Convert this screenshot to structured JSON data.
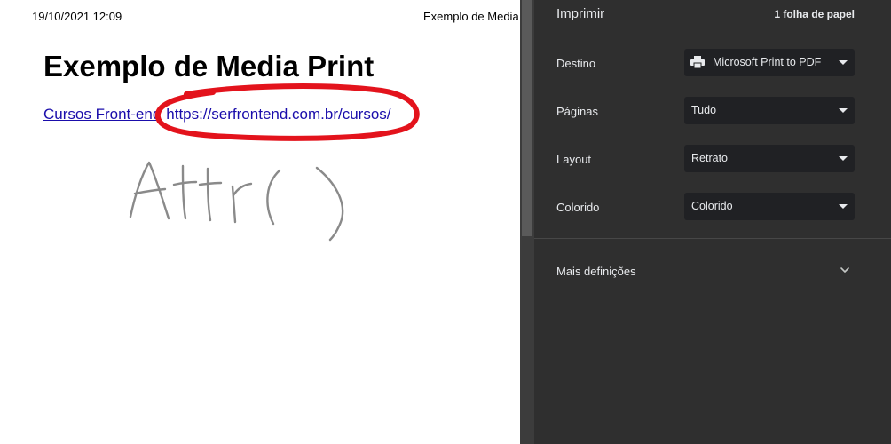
{
  "preview": {
    "header_date": "19/10/2021 12:09",
    "header_title": "Exemplo de Media",
    "heading": "Exemplo de Media Print",
    "link_text": "Cursos Front-end",
    "link_url": "https://serfrontend.com.br/cursos/",
    "handwriting": "Attr( )",
    "annotation_color": "#e3131c"
  },
  "print_panel": {
    "title": "Imprimir",
    "sheet_count": "1 folha de papel",
    "rows": [
      {
        "label": "Destino",
        "value": "Microsoft Print to PDF",
        "icon": "printer-icon"
      },
      {
        "label": "Páginas",
        "value": "Tudo"
      },
      {
        "label": "Layout",
        "value": "Retrato"
      },
      {
        "label": "Colorido",
        "value": "Colorido"
      }
    ],
    "more_settings": "Mais definições",
    "colors": {
      "panel_bg": "#2f2f2f",
      "select_bg": "#202124",
      "text": "#e8eaed"
    }
  }
}
